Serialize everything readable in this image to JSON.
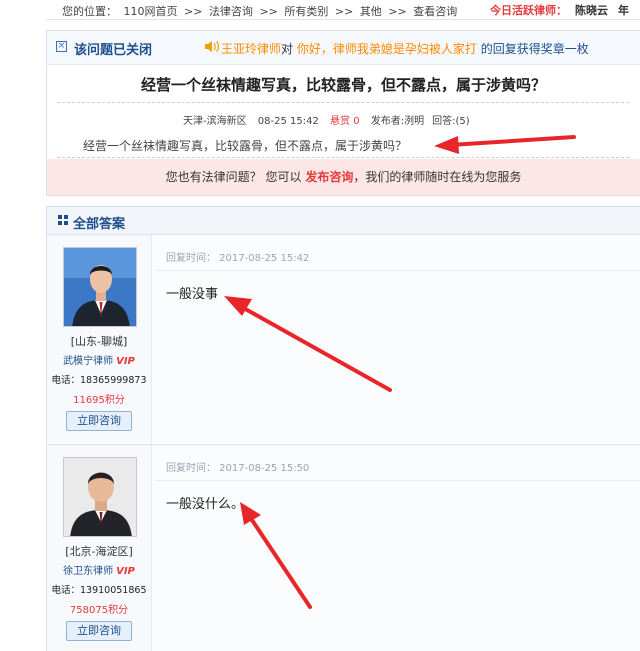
{
  "breadcrumb": {
    "label": "您的位置：",
    "items": [
      "110网首页",
      ">>",
      "法律咨询",
      ">>",
      "所有类别",
      ">>",
      "其他",
      ">>",
      "查看咨询"
    ]
  },
  "today_lawyer": {
    "label": "今日活跃律师：",
    "name": "陈晓云",
    "extra": "年"
  },
  "question": {
    "status": "该问题已关闭",
    "notice": {
      "lawyer": "王亚玲律师",
      "mid": "对",
      "quote": "你好，律师我弟媳是孕妇被人家打",
      "tail": "的回复获得奖章一枚"
    },
    "title": "经营一个丝袜情趣写真，比较露骨，但不露点，属于涉黄吗？",
    "location": "天津-滨海新区",
    "time": "08-25 15:42",
    "reward": "悬赏 0",
    "poster": "发布者:洌明",
    "replies": "回答:(5)",
    "body": "经营一个丝袜情趣写真，比较露骨，但不露点，属于涉黄吗？"
  },
  "promo": {
    "pre": "您也有法律问题？ 您可以",
    "link": "发布咨询",
    "post": "，我们的律师随时在线为您服务"
  },
  "answers_title": "全部答案",
  "answers": [
    {
      "region": "[山东-聊城]",
      "lawyer": "武模宁律师",
      "vip": "VIP",
      "phone": "电话：18365999873",
      "points": "11695积分",
      "consult": "立即咨询",
      "time": "回复时间： 2017-08-25 15:42",
      "text": "一般没事"
    },
    {
      "region": "[北京-海淀区]",
      "lawyer": "徐卫东律师",
      "vip": "VIP",
      "phone": "电话：13910051865",
      "points": "758075积分",
      "consult": "立即咨询",
      "time": "回复时间： 2017-08-25 15:50",
      "text": "一般没什么。"
    }
  ],
  "colors": {
    "accent_red": "#e4393c",
    "link_blue": "#1e4f8c",
    "orange": "#ff8a00",
    "arrow_red": "#e8262a"
  }
}
